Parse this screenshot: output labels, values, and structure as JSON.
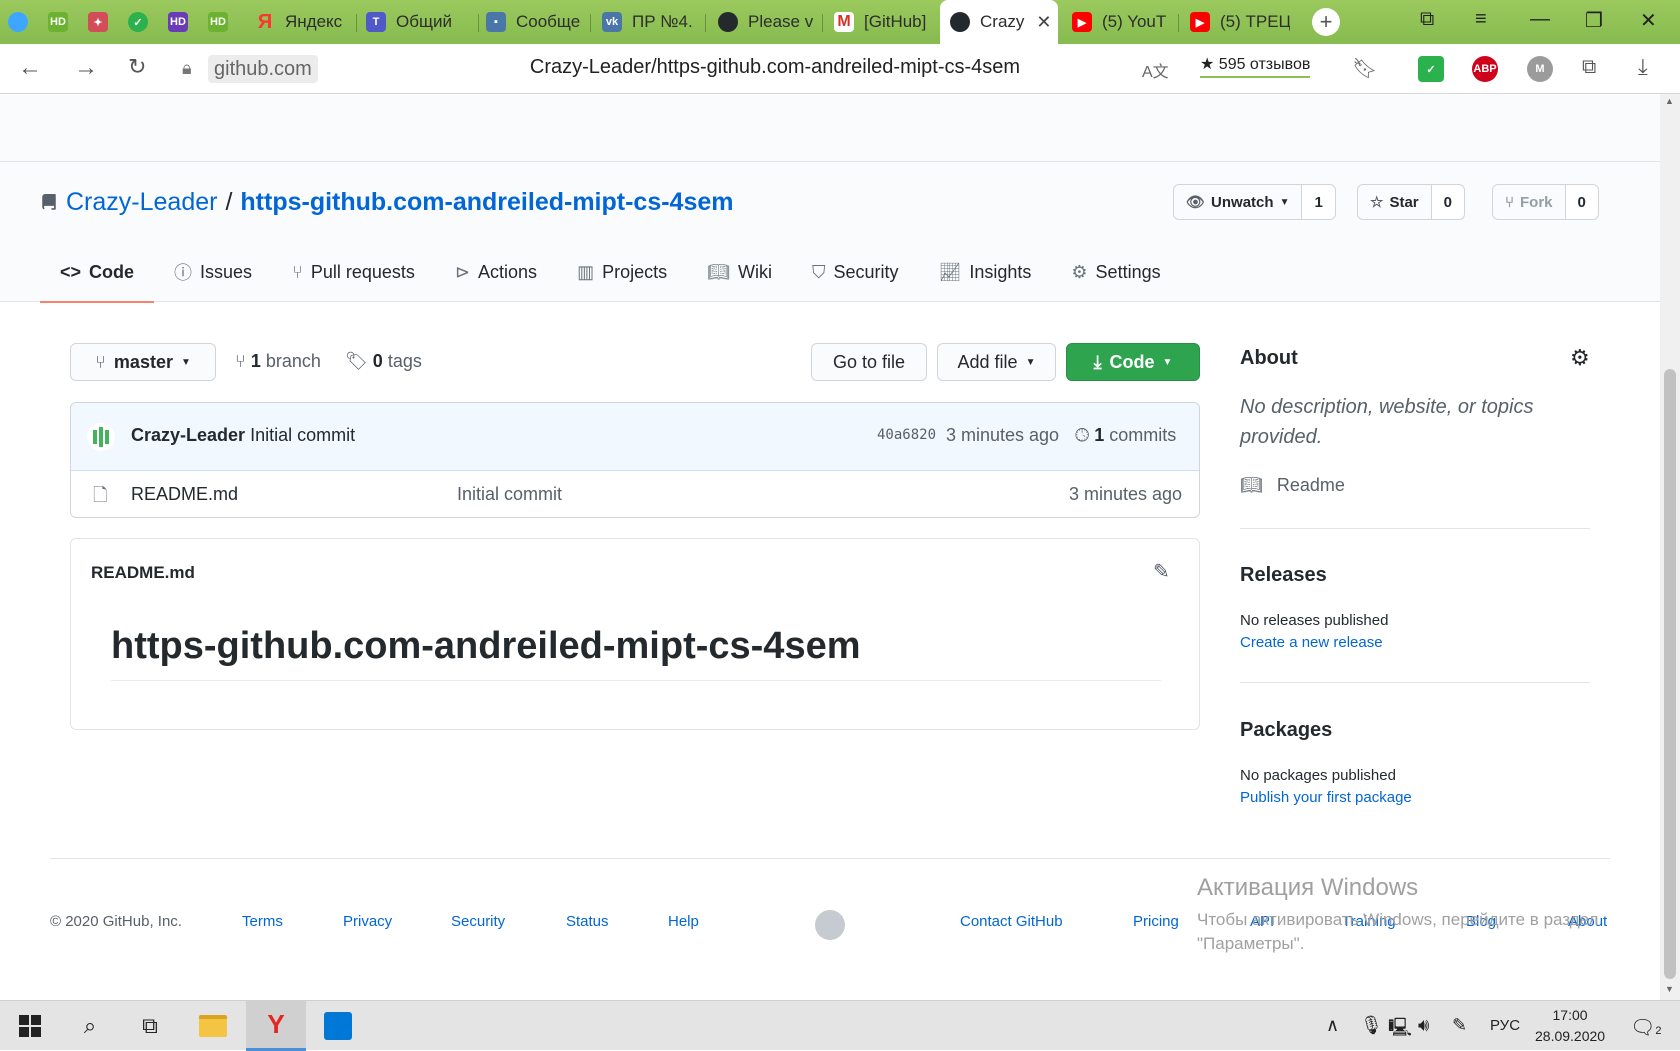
{
  "browser": {
    "tabs": [
      {
        "label": "",
        "icon": "alice-icon",
        "color": "#3ea6ff"
      },
      {
        "label": "",
        "icon": "hd-icon",
        "color": "#6ab22f",
        "badge": "HD"
      },
      {
        "label": "",
        "icon": "game-icon",
        "color": "#d24d57"
      },
      {
        "label": "",
        "icon": "check-icon",
        "color": "#2bb24c"
      },
      {
        "label": "",
        "icon": "hd-purple-icon",
        "color": "#6a3bb8",
        "badge": "HD"
      },
      {
        "label": "",
        "icon": "hd-icon",
        "color": "#6ab22f",
        "badge": "HD"
      },
      {
        "label": "Яндекс",
        "icon": "yandex-icon",
        "color": "#f33"
      },
      {
        "label": "Общий",
        "icon": "teams-icon",
        "color": "#5059c9"
      },
      {
        "label": "Сообще",
        "icon": "chat-icon",
        "color": "#4a76a8"
      },
      {
        "label": "ПР №4.",
        "icon": "vk-icon",
        "color": "#4a76a8"
      },
      {
        "label": "Please v",
        "icon": "github-icon",
        "color": "#24292e"
      },
      {
        "label": "[GitHub]",
        "icon": "gmail-icon",
        "color": "#d93025"
      },
      {
        "label": "Crazy",
        "icon": "github-icon",
        "color": "#24292e",
        "active": true
      },
      {
        "label": "(5) YouT",
        "icon": "youtube-icon",
        "color": "#ff0000"
      },
      {
        "label": "(5) ТРЕЦ",
        "icon": "youtube-icon",
        "color": "#ff0000"
      }
    ],
    "domain": "github.com",
    "page_title": "Crazy-Leader/https-github.com-andreiled-mipt-cs-4sem",
    "reviews": "★ 595 отзывов",
    "ext_labels": {
      "abp": "ABP",
      "m": "M"
    }
  },
  "repo": {
    "owner": "Crazy-Leader",
    "separator": "/",
    "name": "https-github.com-andreiled-mipt-cs-4sem",
    "watch_label": "Unwatch",
    "watch_count": "1",
    "star_label": "Star",
    "star_count": "0",
    "fork_label": "Fork",
    "fork_count": "0"
  },
  "nav": {
    "tabs": [
      "Code",
      "Issues",
      "Pull requests",
      "Actions",
      "Projects",
      "Wiki",
      "Security",
      "Insights",
      "Settings"
    ]
  },
  "main": {
    "branch": "master",
    "branch_count": "1",
    "branch_word": "branch",
    "tag_count": "0",
    "tag_word": "tags",
    "go_to_file": "Go to file",
    "add_file": "Add file",
    "code_btn": "Code",
    "commit_author": "Crazy-Leader",
    "commit_message": "Initial commit",
    "commit_hash": "40a6820",
    "commit_time": "3 minutes ago",
    "commit_count": "1",
    "commit_word": "commits",
    "file_name": "README.md",
    "file_commit": "Initial commit",
    "file_time": "3 minutes ago",
    "readme_title": "README.md",
    "readme_heading": "https-github.com-andreiled-mipt-cs-4sem"
  },
  "sidebar": {
    "about_title": "About",
    "about_desc": "No description, website, or topics provided.",
    "readme_link": "Readme",
    "releases_title": "Releases",
    "releases_text": "No releases published",
    "releases_link": "Create a new release",
    "packages_title": "Packages",
    "packages_text": "No packages published",
    "packages_link": "Publish your first package"
  },
  "footer": {
    "copyright": "© 2020 GitHub, Inc.",
    "links_left": [
      "Terms",
      "Privacy",
      "Security",
      "Status",
      "Help"
    ],
    "links_right": [
      "Contact GitHub",
      "Pricing",
      "API",
      "Training",
      "Blog",
      "About"
    ]
  },
  "watermark": {
    "title": "Активация Windows",
    "line1": "Чтобы активировать Windows, перейдите в раздел",
    "line2": "\"Параметры\"."
  },
  "taskbar": {
    "lang": "РУС",
    "time": "17:00",
    "date": "28.09.2020",
    "notif_count": "2"
  },
  "colors": {
    "accent": "#0366d6",
    "green_btn": "#2ea44f",
    "tab_bar": "#8cc152",
    "selected_underline": "#f9826c"
  }
}
